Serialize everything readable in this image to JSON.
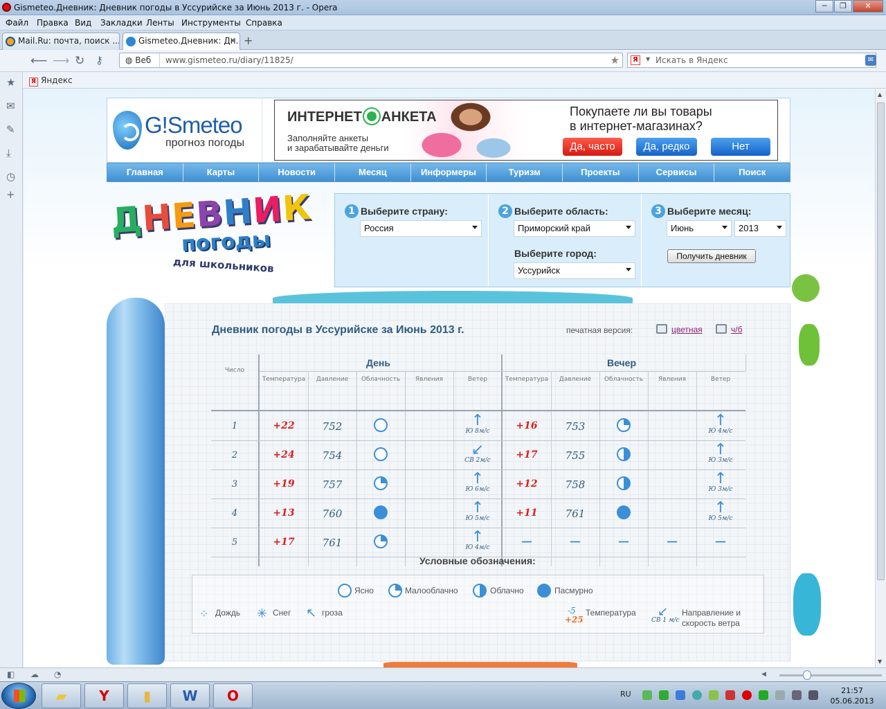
{
  "window": {
    "title": "Gismeteo.Дневник: Дневник погоды в Уссурийске за Июнь 2013 г. - Opera",
    "minimize": "─",
    "maximize": "❐",
    "close": "✕"
  },
  "menu": [
    "Файл",
    "Правка",
    "Вид",
    "Закладки",
    "Ленты",
    "Инструменты",
    "Справка"
  ],
  "tabs": [
    {
      "label": "Mail.Ru: почта, поиск ...",
      "close": "✕"
    },
    {
      "label": "Gismeteo.Дневник: Дн...",
      "close": "✕"
    }
  ],
  "new_tab": "+",
  "address": {
    "scope": "Веб",
    "url": "www.gismeteo.ru/diary/11825/",
    "search_placeholder": "Искать в Яндекс",
    "search_engine_letter": "Я"
  },
  "bookmarks": [
    "Яндекс"
  ],
  "site": {
    "brand": "G!Smeteo",
    "slogan": "прогноз погоды",
    "nav": [
      "Главная",
      "Карты",
      "Новости",
      "Месяц",
      "Информеры",
      "Туризм",
      "Проекты",
      "Сервисы",
      "Поиск"
    ]
  },
  "banner": {
    "title_left": "ИНТЕРНЕТ",
    "title_right": "АНКЕТА",
    "sub_line1": "Заполняйте анкеты",
    "sub_line2": "и зарабатывайте деньги",
    "question_line1": "Покупаете ли вы товары",
    "question_line2": "в интернет-магазинах?",
    "btn_often": "Да, часто",
    "btn_rarely": "Да, редко",
    "btn_no": "Нет"
  },
  "diary_logo": {
    "word1_letters": [
      "Д",
      "Н",
      "Е",
      "В",
      "Н",
      "И",
      "К"
    ],
    "word1_colors": [
      "#27ae60",
      "#e74c3c",
      "#f39c12",
      "#8e44ad",
      "#2f7fc8",
      "#e91e63",
      "#f1c40f"
    ],
    "word2": "погоды",
    "word3": "для школьников"
  },
  "selector": {
    "step1": {
      "num": "1",
      "label": "Выберите страну:",
      "value": "Россия"
    },
    "step2": {
      "num": "2",
      "label": "Выберите область:",
      "value": "Приморский край",
      "city_label": "Выберите город:",
      "city_value": "Уссурийск"
    },
    "step3": {
      "num": "3",
      "label": "Выберите месяц:",
      "month": "Июнь",
      "year": "2013"
    },
    "button": "Получить дневник"
  },
  "diary": {
    "title": "Дневник погоды в Уссурийске за Июнь 2013 г.",
    "print_label": "печатная версия:",
    "print_color": "цветная",
    "print_bw": "ч/б",
    "col_day_number": "Число",
    "group_day": "День",
    "group_evening": "Вечер",
    "columns": [
      "Температура",
      "Давление",
      "Облачность",
      "Явления",
      "Ветер"
    ],
    "rows": [
      {
        "day": "1",
        "d_temp": "+22",
        "d_press": "752",
        "d_cloud": "clear",
        "d_wind": "Ю 8м/с",
        "d_wind_arrow": "↑",
        "e_temp": "+16",
        "e_press": "753",
        "e_cloud": "partly",
        "e_wind": "Ю 4м/с",
        "e_wind_arrow": "↑"
      },
      {
        "day": "2",
        "d_temp": "+24",
        "d_press": "754",
        "d_cloud": "clear",
        "d_wind": "СВ 2м/с",
        "d_wind_arrow": "↙",
        "e_temp": "+17",
        "e_press": "755",
        "e_cloud": "cloudy",
        "e_wind": "Ю 3м/с",
        "e_wind_arrow": "↑"
      },
      {
        "day": "3",
        "d_temp": "+19",
        "d_press": "757",
        "d_cloud": "partly",
        "d_wind": "Ю 6м/с",
        "d_wind_arrow": "↑",
        "e_temp": "+12",
        "e_press": "758",
        "e_cloud": "cloudy",
        "e_wind": "Ю 3м/с",
        "e_wind_arrow": "↑"
      },
      {
        "day": "4",
        "d_temp": "+13",
        "d_press": "760",
        "d_cloud": "overcast",
        "d_wind": "Ю 5м/с",
        "d_wind_arrow": "↑",
        "e_temp": "+11",
        "e_press": "761",
        "e_cloud": "overcast",
        "e_wind": "Ю 5м/с",
        "e_wind_arrow": "↑"
      },
      {
        "day": "5",
        "d_temp": "+17",
        "d_press": "761",
        "d_cloud": "partly",
        "d_wind": "Ю 4м/с",
        "d_wind_arrow": "↑",
        "e_temp": "—",
        "e_press": "—",
        "e_cloud": "—",
        "e_phen": "—",
        "e_wind": "—"
      }
    ]
  },
  "legend": {
    "title": "Условные обозначения:",
    "clear": "Ясно",
    "partly": "Малооблачно",
    "cloudy": "Облачно",
    "overcast": "Пасмурно",
    "rain": "Дождь",
    "snow": "Снег",
    "storm": "гроза",
    "temp_sample_cold": "-5",
    "temp_sample_warm": "+25",
    "temp_label": "Температура",
    "wind_sample": "СВ 1 м/с",
    "wind_label_1": "Направление и",
    "wind_label_2": "скорость ветра"
  },
  "taskbar": {
    "lang": "RU",
    "time": "21:57",
    "date": "05.06.2013"
  },
  "colors": {
    "accent": "#3a8fd8",
    "temperature": "#d81f1f",
    "nav": "#4f9fdc"
  }
}
